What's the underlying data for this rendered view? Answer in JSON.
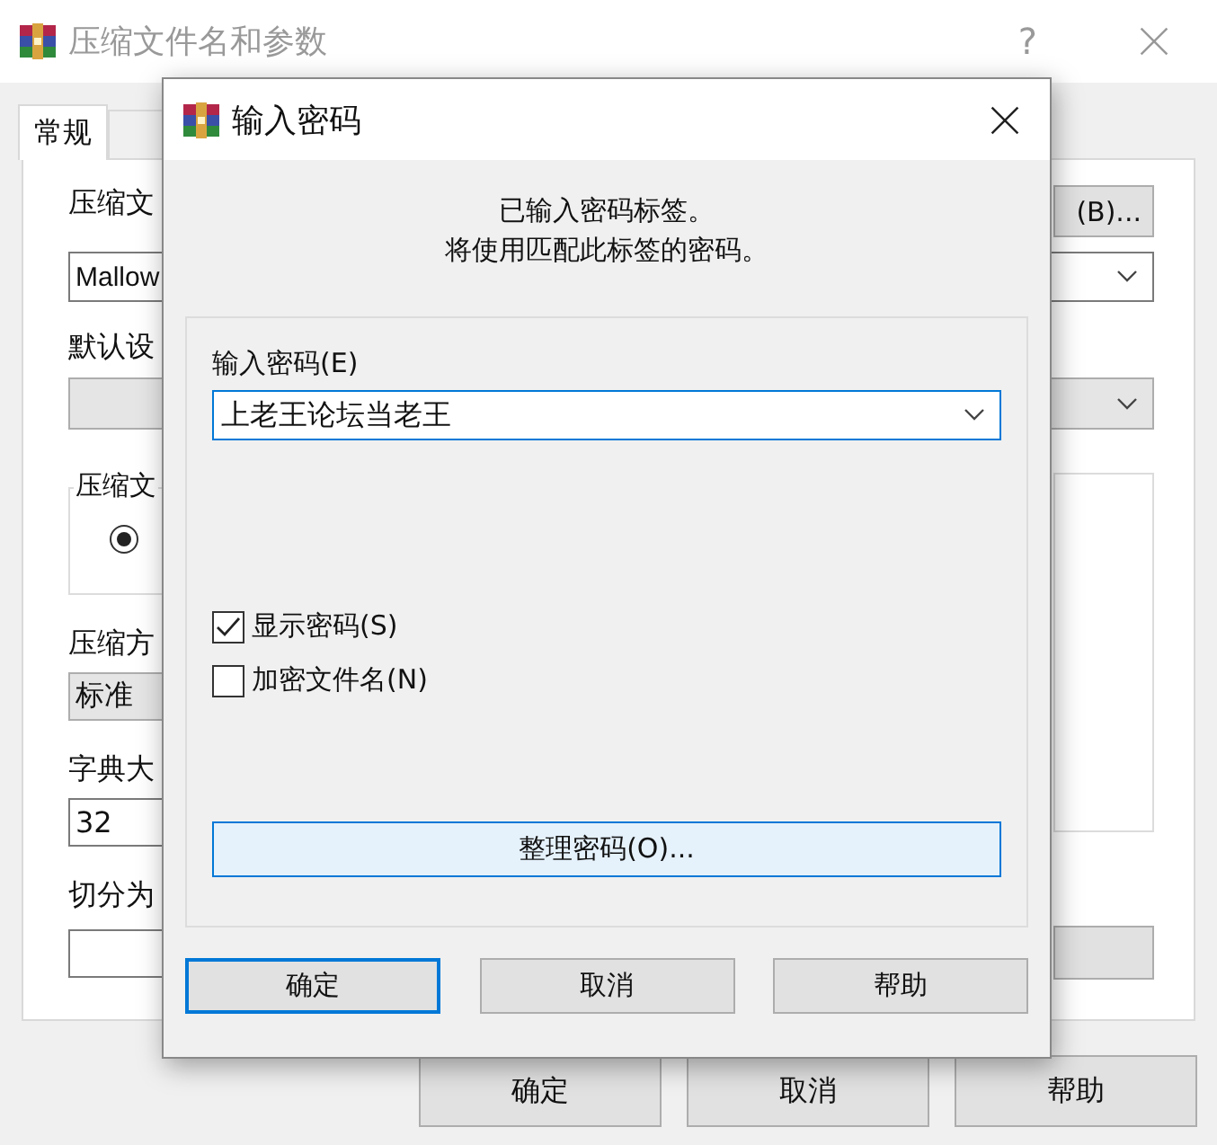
{
  "main_window": {
    "title": "压缩文件名和参数",
    "help_button": "?",
    "tabs": [
      {
        "label": "常规",
        "selected": true
      }
    ],
    "archive_name_label": "压缩文",
    "archive_name_value": "Mallow",
    "browse_button": "(B)...",
    "profile_label": "默认设",
    "format_group_label": "压缩文",
    "format_radio_selected": true,
    "method_label": "压缩方",
    "method_value": "标准",
    "dictionary_label": "字典大",
    "dictionary_value": "32",
    "split_label": "切分为",
    "buttons": [
      "确定",
      "取消",
      "帮助"
    ]
  },
  "dialog": {
    "title": "输入密码",
    "message_lines": [
      "已输入密码标签。",
      "将使用匹配此标签的密码。"
    ],
    "password_label": "输入密码(E)",
    "password_value": "上老王论坛当老王",
    "checkboxes": [
      {
        "label": "显示密码(S)",
        "checked": true
      },
      {
        "label": "加密文件名(N)",
        "checked": false
      }
    ],
    "organize_button": "整理密码(O)...",
    "buttons": [
      {
        "label": "确定",
        "default": true
      },
      {
        "label": "取消",
        "default": false
      },
      {
        "label": "帮助",
        "default": false
      }
    ]
  }
}
